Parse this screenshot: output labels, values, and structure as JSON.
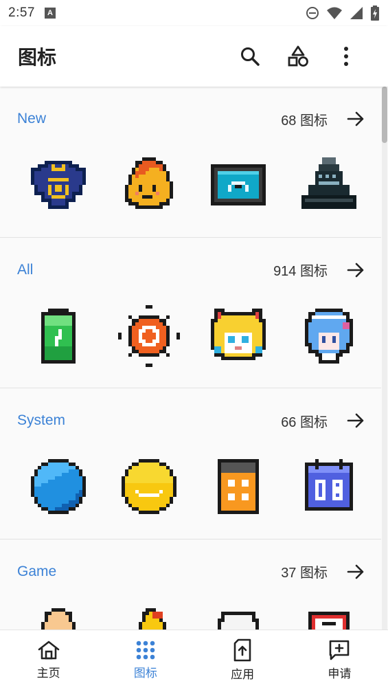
{
  "status_bar": {
    "time": "2:57",
    "notif_letter": "A"
  },
  "app_bar": {
    "title": "图标"
  },
  "accent": "#3c82d6",
  "sections": [
    {
      "title": "New",
      "count": "68 图标"
    },
    {
      "title": "All",
      "count": "914 图标"
    },
    {
      "title": "System",
      "count": "66 图标"
    },
    {
      "title": "Game",
      "count": "37 图标"
    }
  ],
  "bottom_nav": [
    {
      "label": "主页",
      "icon": "home-icon",
      "active": false
    },
    {
      "label": "图标",
      "icon": "grid-icon",
      "active": true
    },
    {
      "label": "应用",
      "icon": "app-upload-icon",
      "active": false
    },
    {
      "label": "申请",
      "icon": "request-icon",
      "active": false
    }
  ]
}
